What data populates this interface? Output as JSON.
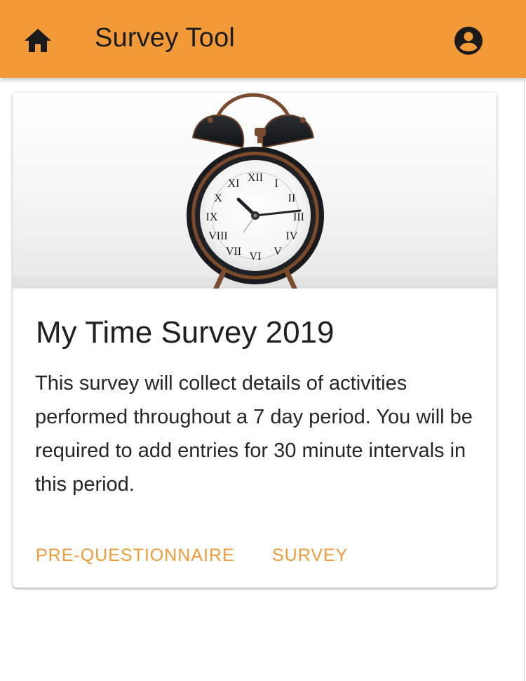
{
  "theme": {
    "accent": "#F29A38",
    "appbar_text": "#1C1C1C"
  },
  "appbar": {
    "title": "Survey Tool",
    "home_icon": "home-icon",
    "account_icon": "account-circle-icon"
  },
  "card": {
    "image": "alarm-clock-photo",
    "title": "My Time Survey 2019",
    "description": "This survey will collect details of activities performed throughout a 7 day period. You will be required to add entries for 30 minute intervals in this period.",
    "actions": {
      "pre_questionnaire": "PRE-QUESTIONNAIRE",
      "survey": "SURVEY"
    }
  }
}
